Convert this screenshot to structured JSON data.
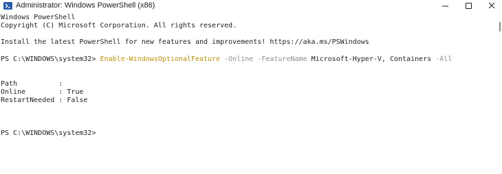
{
  "window": {
    "title": "Administrator: Windows PowerShell (x86)",
    "icon": "powershell-icon",
    "controls": [
      "minimize-icon",
      "maximize-icon",
      "close-icon"
    ]
  },
  "terminal": {
    "lines": {
      "l1": "Windows PowerShell",
      "l2": "Copyright (C) Microsoft Corporation. All rights reserved.",
      "l3": "Install the latest PowerShell for new features and improvements! https://aka.ms/PSWindows",
      "prompt1": "PS C:\\WINDOWS\\system32> ",
      "cmdlet": "Enable-WindowsOptionalFeature",
      "p_online": " -Online",
      "p_featurename": " -FeatureName",
      "arg_featurename": " Microsoft-Hyper-V, Containers",
      "p_all": " -All",
      "out_path": "Path          :",
      "out_online": "Online        : True",
      "out_restart": "RestartNeeded : False",
      "prompt2": "PS C:\\WINDOWS\\system32>"
    },
    "colors": {
      "cmdlet": "#b9900a",
      "parameter": "#8c8c8c",
      "text": "#1e1e1e"
    }
  }
}
